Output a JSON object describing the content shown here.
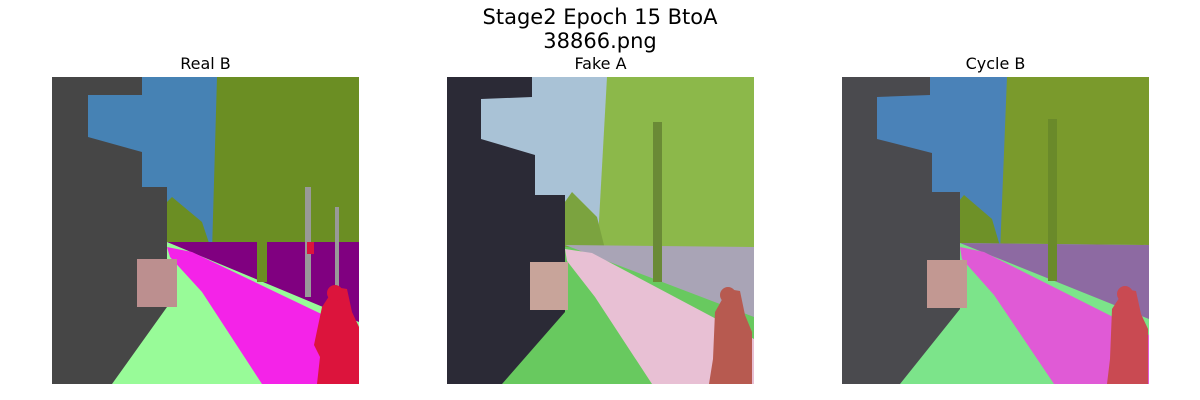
{
  "figure": {
    "title_line1": "Stage2 Epoch 15 BtoA",
    "title_line2": "38866.png"
  },
  "panels": [
    {
      "title": "Real B"
    },
    {
      "title": "Fake A"
    },
    {
      "title": "Cycle B"
    }
  ],
  "colors": {
    "building": "#464646",
    "sky": "#4682b4",
    "vegetation": "#6b8e23",
    "road": "#800080",
    "sidewalk": "#f423e8",
    "terrain": "#98fb98",
    "person": "#dc143c",
    "wall": "#bc8f8f",
    "pole": "#999999"
  }
}
